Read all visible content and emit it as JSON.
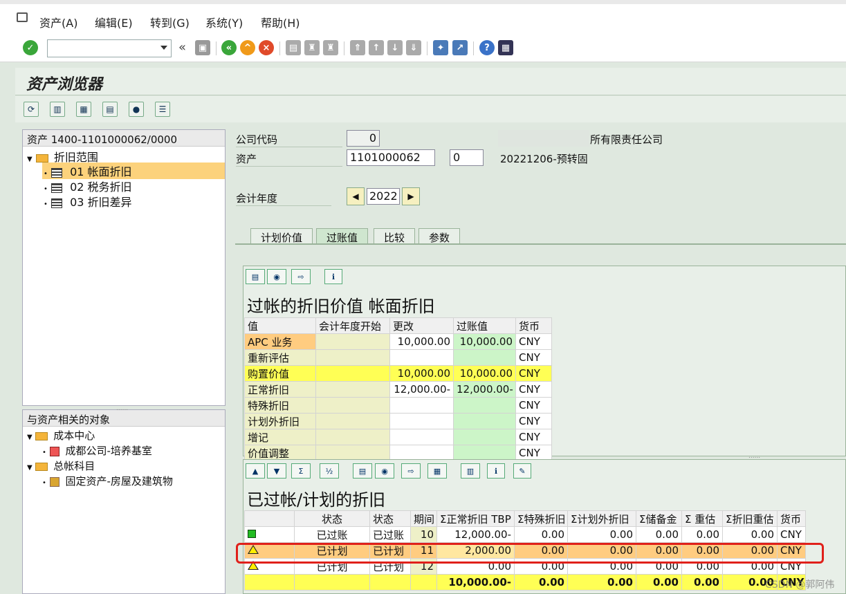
{
  "menu": [
    "资产(A)",
    "编辑(E)",
    "转到(G)",
    "系统(Y)",
    "帮助(H)"
  ],
  "window": {
    "title": "资产浏览器"
  },
  "tree": {
    "header": "资产 1400-1101000062/0000",
    "root": "折旧范围",
    "items": [
      "01  帐面折旧",
      "02  税务折旧",
      "03  折旧差异"
    ]
  },
  "objects": {
    "header": "与资产相关的对象",
    "group1": "成本中心",
    "group1_item": "成都公司-培养基室",
    "group2": "总帐科目",
    "group2_item": "固定资产-房屋及建筑物"
  },
  "form": {
    "company_label": "公司代码",
    "company_value": "0",
    "company_name": "所有限责任公司",
    "asset_label": "资产",
    "asset_value": "1101000062",
    "sub_value": "0",
    "asset_desc": "20221206-预转固",
    "year_label": "会计年度",
    "year_value": "2022"
  },
  "tabs": [
    "计划价值",
    "过账值",
    "比较",
    "参数"
  ],
  "posted": {
    "title": "过帐的折旧价值 帐面折旧",
    "headers": [
      "值",
      "会计年度开始",
      "更改",
      "过账值",
      "货币"
    ],
    "rows": [
      [
        "APC 业务",
        "",
        "10,000.00",
        "10,000.00",
        "CNY"
      ],
      [
        "重新评估",
        "",
        "",
        "",
        "CNY"
      ],
      [
        "购置价值",
        "",
        "10,000.00",
        "10,000.00",
        "CNY"
      ],
      [
        "正常折旧",
        "",
        "12,000.00-",
        "12,000.00-",
        "CNY"
      ],
      [
        "特殊折旧",
        "",
        "",
        "",
        "CNY"
      ],
      [
        "计划外折旧",
        "",
        "",
        "",
        "CNY"
      ],
      [
        "增记",
        "",
        "",
        "",
        "CNY"
      ],
      [
        "价值调整",
        "",
        "",
        "",
        "CNY"
      ]
    ]
  },
  "planned": {
    "title": "已过帐/计划的折旧",
    "headers": [
      "",
      "状态",
      "状态",
      "期间",
      "Σ正常折旧 TBP",
      "Σ特殊折旧",
      "Σ计划外折旧",
      "Σ储备金",
      "Σ   重估",
      "Σ折旧重估",
      "货币"
    ],
    "rows": [
      {
        "status_icon": "green-square-icon",
        "status": "已过账",
        "status2": "已过账",
        "period": "10",
        "normal": "12,000.00-",
        "special": "0.00",
        "unplanned": "0.00",
        "reserve": "0.00",
        "reval": "0.00",
        "dep_reval": "0.00",
        "currency": "CNY"
      },
      {
        "status_icon": "warning-triangle-icon",
        "status": "已计划",
        "status2": "已计划",
        "period": "11",
        "normal": "2,000.00",
        "special": "0.00",
        "unplanned": "0.00",
        "reserve": "0.00",
        "reval": "0.00",
        "dep_reval": "0.00",
        "currency": "CNY"
      },
      {
        "status_icon": "warning-triangle-icon",
        "status": "已计划",
        "status2": "已计划",
        "period": "12",
        "normal": "0.00",
        "special": "0.00",
        "unplanned": "0.00",
        "reserve": "0.00",
        "reval": "0.00",
        "dep_reval": "0.00",
        "currency": "CNY"
      }
    ],
    "total": {
      "normal": "10,000.00-",
      "special": "0.00",
      "unplanned": "0.00",
      "reserve": "0.00",
      "reval": "0.00",
      "dep_reval": "0.00",
      "currency": "CNY"
    }
  },
  "watermark": "CSDN @郭阿伟"
}
